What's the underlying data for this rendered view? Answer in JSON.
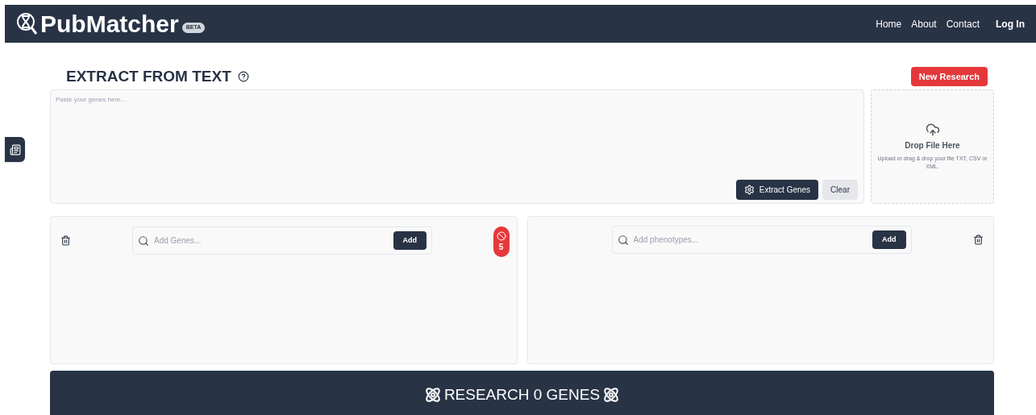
{
  "header": {
    "logo": "PubMatcher",
    "badge": "BETA",
    "nav": [
      {
        "label": "Home",
        "kind": "link"
      },
      {
        "label": "About",
        "kind": "link"
      },
      {
        "label": "Contact",
        "kind": "link"
      },
      {
        "label": "Log In",
        "kind": "login"
      }
    ]
  },
  "extract": {
    "title": "EXTRACT FROM TEXT",
    "new_research": "New Research",
    "placeholder": "Paste your genes here...",
    "extract_button": "Extract Genes",
    "clear_button": "Clear"
  },
  "drop": {
    "title": "Drop File Here",
    "hint": "Upload or drag & drop your file TXT, CSV or XML."
  },
  "genes": {
    "placeholder": "Add Genes...",
    "add": "Add",
    "count": "5"
  },
  "phenotypes": {
    "placeholder": "Add phenotypes...",
    "add": "Add"
  },
  "research_button": "RESEARCH 0 GENES"
}
